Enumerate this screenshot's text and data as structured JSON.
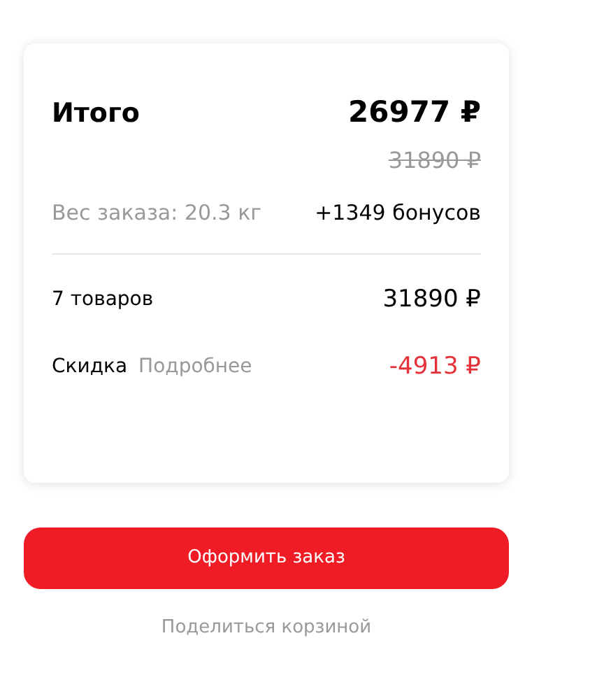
{
  "summary": {
    "title": "Итого",
    "total": "26977 ₽",
    "old_total": "31890 ₽",
    "weight": "Вес заказа: 20.3 кг",
    "bonuses": "+1349 бонусов",
    "items": {
      "label": "7 товаров",
      "value": "31890 ₽"
    },
    "discount": {
      "label": "Скидка",
      "link": "Подробнее",
      "value": "-4913 ₽"
    }
  },
  "checkout_button": "Оформить заказ",
  "share_link": "Поделиться корзиной"
}
